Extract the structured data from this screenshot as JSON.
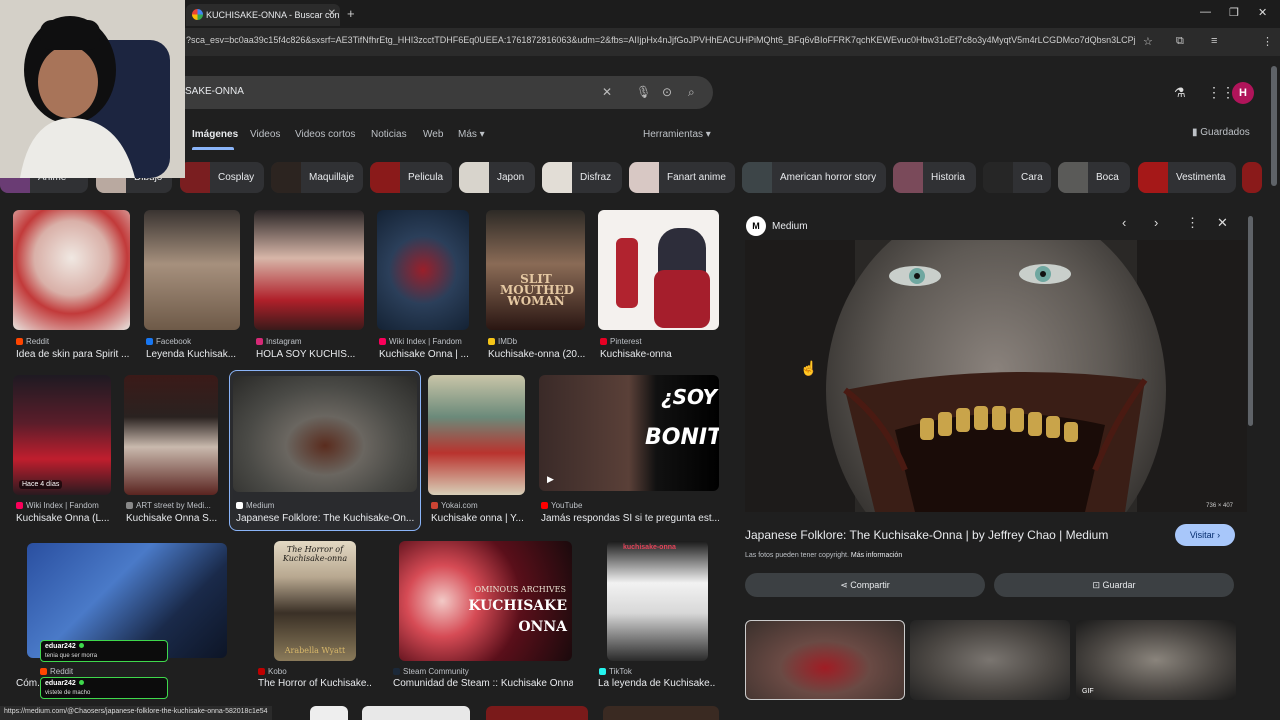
{
  "browser": {
    "tab_title": "KUCHISAKE-ONNA - Buscar con Google",
    "new_tab": "+",
    "url": "?sca_esv=bc0aa39c15f4c826&sxsrf=AE3TifNfhrEtg_HHI3zcctTDHF6Eq0UEEA:1761872816063&udm=2&fbs=AIIjpHx4nJjfGoJPVHhEACUHPiMQht6_BFq6vBIoFFRK7qchKEWEvuc0Hbw31oEf7c8o3y4MyqtV5m4rLCGDMco7dQbsn3LCPj...",
    "profile_initial": "H",
    "minimize": "—",
    "restore": "❐",
    "close": "✕"
  },
  "search": {
    "query": "SAKE-ONNA",
    "avatar_initial": "H"
  },
  "nav_tabs": [
    "Imágenes",
    "Videos",
    "Videos cortos",
    "Noticias",
    "Web",
    "Más ▾",
    "Herramientas ▾"
  ],
  "saved_label": "Guardados",
  "chips": [
    "Anime",
    "Dibujo",
    "Cosplay",
    "Maquillaje",
    "Pelicula",
    "Japon",
    "Disfraz",
    "Fanart anime",
    "American horror story",
    "Historia",
    "Cara",
    "Boca",
    "Vestimenta"
  ],
  "results": [
    {
      "source": "Reddit",
      "title": "Idea de skin para Spirit ..."
    },
    {
      "source": "Facebook",
      "title": "Leyenda Kuchisak..."
    },
    {
      "source": "Instagram",
      "title": "HOLA SOY KUCHIS..."
    },
    {
      "source": "Wiki Index | Fandom",
      "title": "Kuchisake Onna | ..."
    },
    {
      "source": "IMDb",
      "title": "Kuchisake-onna (20..."
    },
    {
      "source": "Pinterest",
      "title": "Kuchisake-onna"
    },
    {
      "source": "Wiki Index | Fandom",
      "title": "Kuchisake Onna (L..."
    },
    {
      "source": "ART street by Medi...",
      "title": "Kuchisake Onna S..."
    },
    {
      "source": "Medium",
      "title": "Japanese Folklore: The Kuchisake-On..."
    },
    {
      "source": "Yokai.com",
      "title": "Kuchisake onna | Y..."
    },
    {
      "source": "YouTube",
      "title": "Jamás respondas SÍ si te pregunta est..."
    },
    {
      "source": "Reddit",
      "title": "Cóm... con Kuchisak..."
    },
    {
      "source": "Kobo",
      "title": "The Horror of Kuchisake..."
    },
    {
      "source": "Steam Community",
      "title": "Comunidad de Steam :: Kuchisake Onna ..."
    },
    {
      "source": "TikTok",
      "title": "La leyenda de Kuchisake..."
    }
  ],
  "badges": {
    "hace": "Hace 4 días"
  },
  "thumb_texts": {
    "imdb_poster": "SLIT MOUTHED WOMAN",
    "yt_text1": "¿SOY",
    "yt_text2": "BONITA",
    "kobo_top": "The Horror of Kuchisake-onna",
    "kobo_author": "Arabella Wyatt",
    "steam_top": "OMINOUS ARCHIVES",
    "steam_mid": "KUCHISAKE",
    "steam_bot": "ONNA",
    "tiktok_top": "kuchisake-onna"
  },
  "preview": {
    "site": "Medium",
    "logo": "M",
    "dims": "736 × 407",
    "title": "Japanese Folklore: The Kuchisake-Onna | by Jeffrey Chao | Medium",
    "copyright": "Las fotos pueden tener copyright.",
    "more_info": "Más información",
    "visit": "Visitar ›",
    "share": "⋖ Compartir",
    "save": "⊡ Guardar",
    "gif": "GIF"
  },
  "status_url": "https://medium.com/@Chaosers/japanese-folklore-the-kuchisake-onna-582018c1e54",
  "chat": [
    {
      "user": "eduar242",
      "msg": "tenia que ser morra"
    },
    {
      "user": "eduar242",
      "msg": "vistete de macho"
    }
  ]
}
